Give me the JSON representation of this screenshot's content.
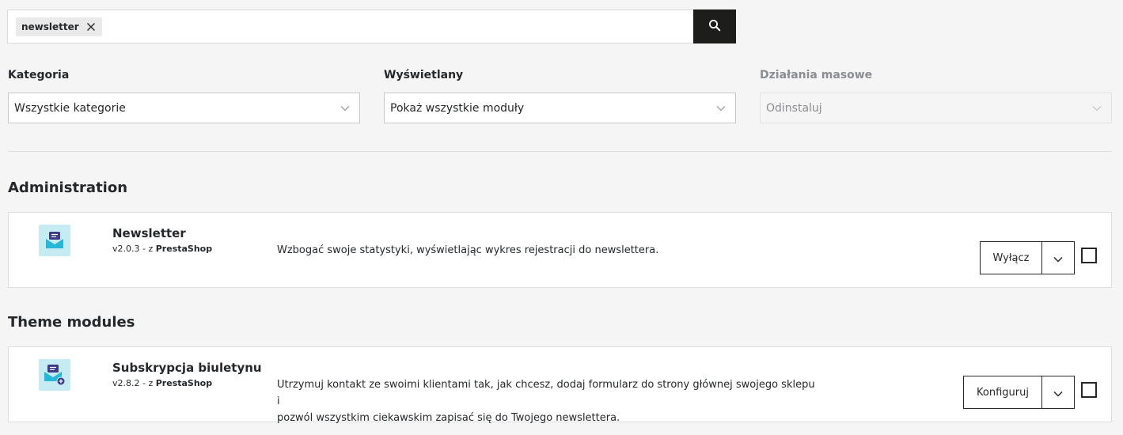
{
  "search": {
    "tag_label": "newsletter"
  },
  "filters": {
    "category": {
      "label": "Kategoria",
      "value": "Wszystkie kategorie"
    },
    "display": {
      "label": "Wyświetlany",
      "value": "Pokaż wszystkie moduły"
    },
    "bulk": {
      "label": "Działania masowe",
      "value": "Odinstaluj"
    }
  },
  "sections": [
    {
      "title": "Administration",
      "module": {
        "name": "Newsletter",
        "version": "v2.0.3",
        "by": "- z",
        "author": "PrestaShop",
        "description": "Wzbogać swoje statystyki, wyświetlając wykres rejestracji do newslettera.",
        "action_label": "Wyłącz"
      }
    },
    {
      "title": "Theme modules",
      "module": {
        "name": "Subskrypcja biuletynu",
        "version": "v2.8.2",
        "by": "- z",
        "author": "PrestaShop",
        "description_line1": "Utrzymuj kontakt ze swoimi klientami tak, jak chcesz, dodaj formularz do strony głównej swojego sklepu i",
        "description_line2": "pozwól wszystkim ciekawskim zapisać się do Twojego newslettera.",
        "action_label": "Konfiguruj"
      }
    }
  ],
  "colors": {
    "accent": "#1d1d1b",
    "icon_bg": "#c4ecf2",
    "icon_primary": "#3d3a87",
    "icon_secondary": "#25b9d7"
  }
}
